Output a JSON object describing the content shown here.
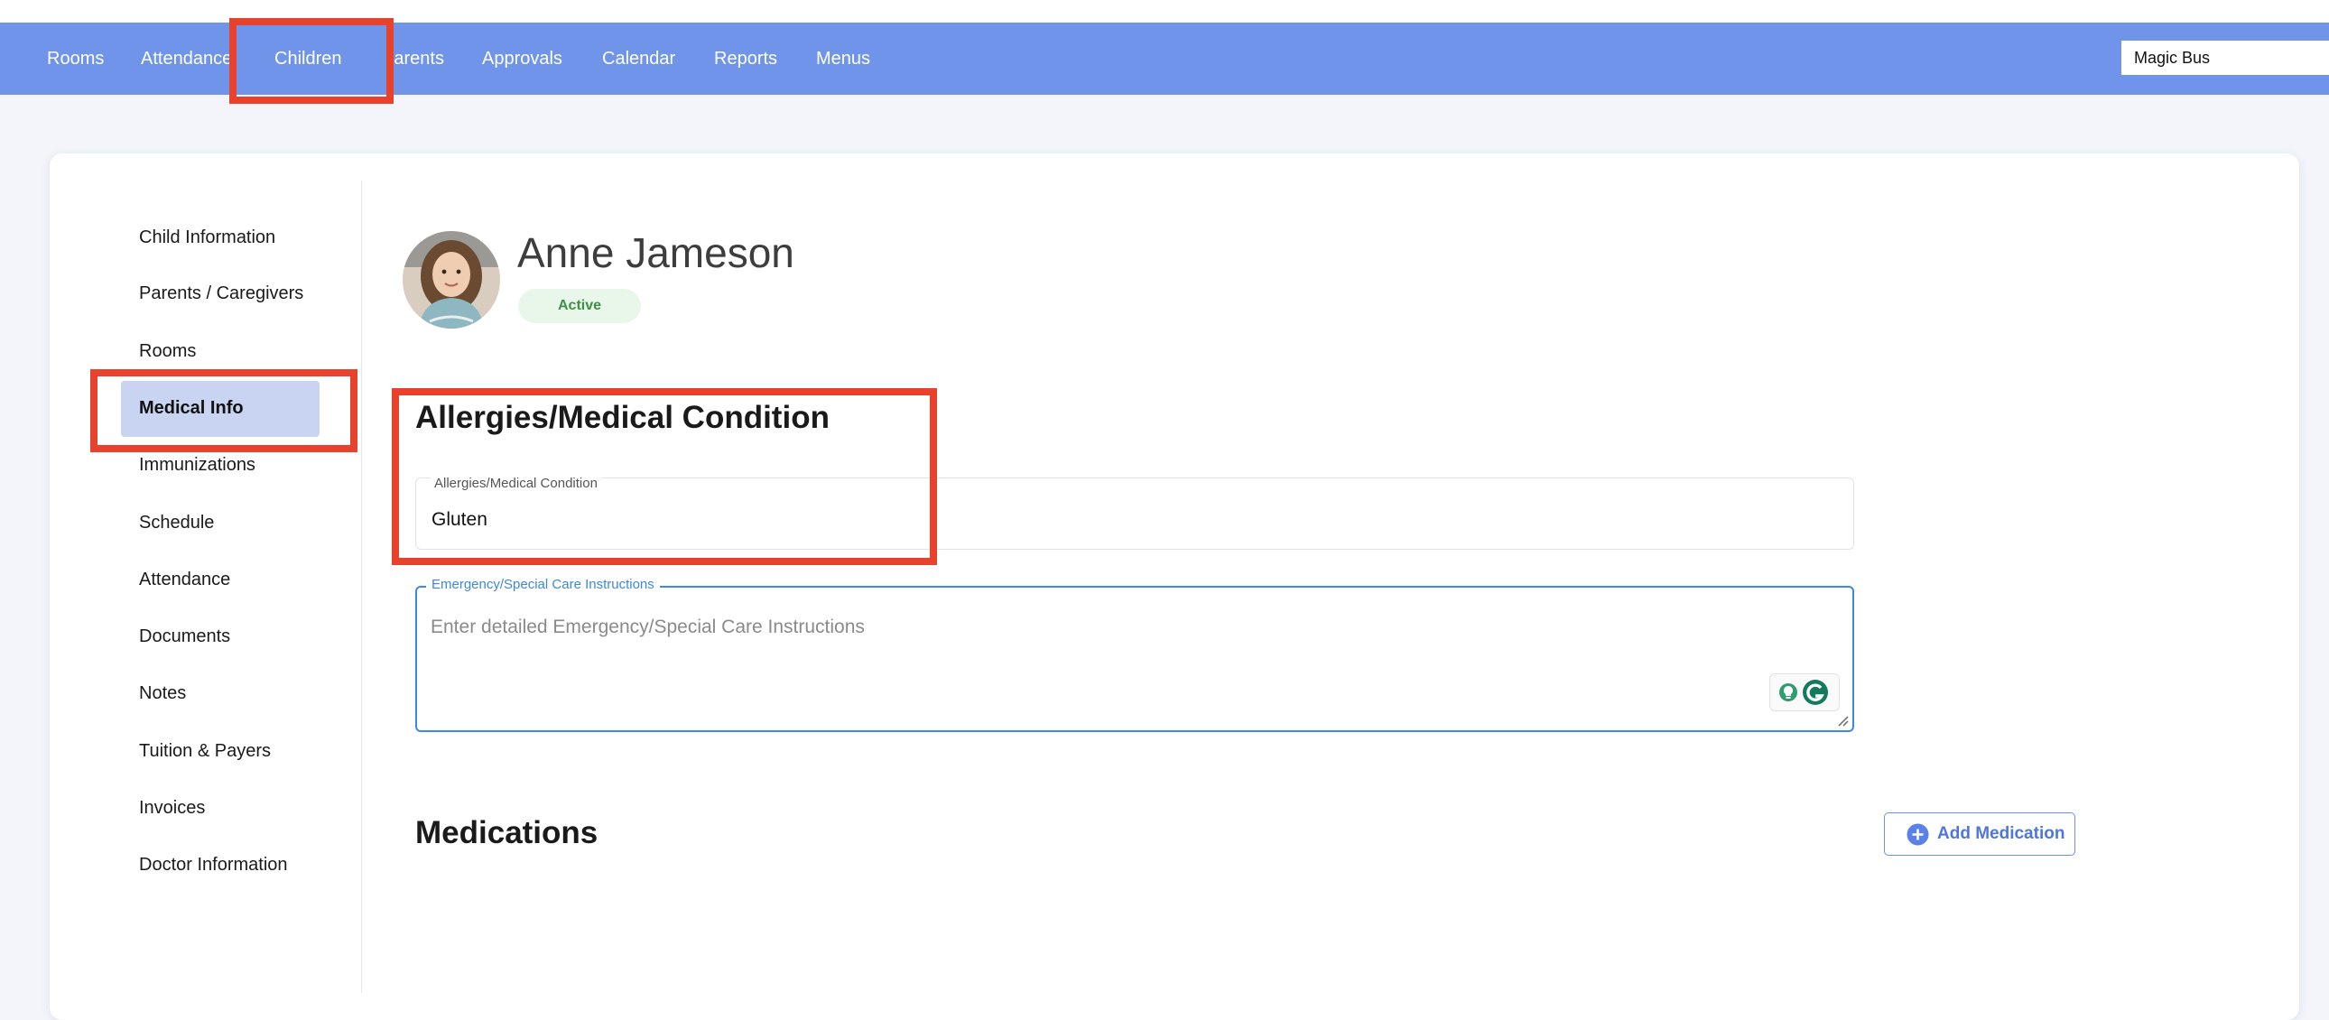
{
  "nav": {
    "items": [
      "Rooms",
      "Attendance",
      "Children",
      "Parents",
      "Approvals",
      "Calendar",
      "Reports",
      "Menus"
    ],
    "company": "Magic Bus"
  },
  "sidebar": {
    "items": [
      {
        "label": "Child Information"
      },
      {
        "label": "Parents / Caregivers"
      },
      {
        "label": "Rooms"
      },
      {
        "label": "Medical Info"
      },
      {
        "label": "Immunizations"
      },
      {
        "label": "Schedule"
      },
      {
        "label": "Attendance"
      },
      {
        "label": "Documents"
      },
      {
        "label": "Notes"
      },
      {
        "label": "Tuition & Payers"
      },
      {
        "label": "Invoices"
      },
      {
        "label": "Doctor Information"
      }
    ],
    "active": "Medical Info"
  },
  "child": {
    "name": "Anne Jameson",
    "status": "Active"
  },
  "allergies": {
    "section_title": "Allergies/Medical Condition",
    "field_label": "Allergies/Medical Condition",
    "field_value": "Gluten"
  },
  "emergency": {
    "field_label": "Emergency/Special Care Instructions",
    "placeholder": "Enter detailed Emergency/Special Care Instructions"
  },
  "medications": {
    "section_title": "Medications",
    "add_button": "Add Medication"
  },
  "colors": {
    "nav_bg": "#7094ea",
    "highlight": "#e8412c",
    "accent_blue": "#3d88e0",
    "active_sidebar_bg": "#c9d4f2",
    "status_green": "#3f8f46"
  },
  "icons": {
    "add": "plus-circle-icon",
    "grammar": "grammarly-icon",
    "idea": "lightbulb-icon"
  }
}
